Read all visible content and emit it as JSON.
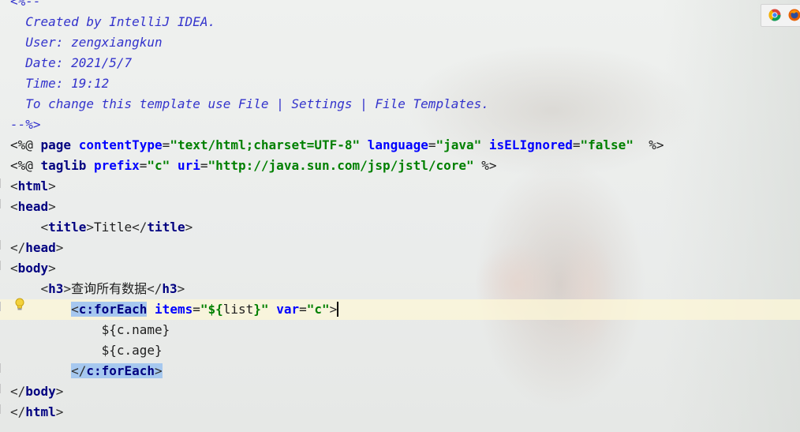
{
  "editor": {
    "lines": [
      {
        "id": "l0",
        "segs": [
          {
            "c": "c",
            "t": "<%--"
          }
        ]
      },
      {
        "id": "l1",
        "segs": [
          {
            "c": "c",
            "t": "  Created by IntelliJ IDEA."
          }
        ]
      },
      {
        "id": "l2",
        "segs": [
          {
            "c": "c",
            "t": "  User: zengxiangkun"
          }
        ]
      },
      {
        "id": "l3",
        "segs": [
          {
            "c": "c",
            "t": "  Date: 2021/5/7"
          }
        ]
      },
      {
        "id": "l4",
        "segs": [
          {
            "c": "c",
            "t": "  Time: 19:12"
          }
        ]
      },
      {
        "id": "l5",
        "segs": [
          {
            "c": "c",
            "t": "  To change this template use File | Settings | File Templates."
          }
        ]
      },
      {
        "id": "l6",
        "segs": [
          {
            "c": "c",
            "t": "--%>"
          }
        ]
      },
      {
        "id": "l7",
        "segs": [
          {
            "c": "d",
            "t": "<%@ "
          },
          {
            "c": "tg",
            "t": "page "
          },
          {
            "c": "at",
            "t": "contentType"
          },
          {
            "c": "eq",
            "t": "="
          },
          {
            "c": "st",
            "t": "\"text/html;charset=UTF-8\" "
          },
          {
            "c": "at",
            "t": "language"
          },
          {
            "c": "eq",
            "t": "="
          },
          {
            "c": "st",
            "t": "\"java\" "
          },
          {
            "c": "at",
            "t": "isELIgnored"
          },
          {
            "c": "eq",
            "t": "="
          },
          {
            "c": "st",
            "t": "\"false\""
          },
          {
            "c": "d",
            "t": "  %>"
          }
        ]
      },
      {
        "id": "l8",
        "segs": [
          {
            "c": "d",
            "t": "<%@ "
          },
          {
            "c": "tg",
            "t": "taglib "
          },
          {
            "c": "at",
            "t": "prefix"
          },
          {
            "c": "eq",
            "t": "="
          },
          {
            "c": "st",
            "t": "\"c\" "
          },
          {
            "c": "at",
            "t": "uri"
          },
          {
            "c": "eq",
            "t": "="
          },
          {
            "c": "st",
            "t": "\"http://java.sun.com/jsp/jstl/core\""
          },
          {
            "c": "d",
            "t": " %>"
          }
        ]
      },
      {
        "id": "l9",
        "segs": [
          {
            "c": "br",
            "t": "<"
          },
          {
            "c": "tg",
            "t": "html"
          },
          {
            "c": "br",
            "t": ">"
          }
        ]
      },
      {
        "id": "l10",
        "segs": [
          {
            "c": "br",
            "t": "<"
          },
          {
            "c": "tg",
            "t": "head"
          },
          {
            "c": "br",
            "t": ">"
          }
        ]
      },
      {
        "id": "l11",
        "segs": [
          {
            "c": "pl",
            "t": "    "
          },
          {
            "c": "br",
            "t": "<"
          },
          {
            "c": "tg",
            "t": "title"
          },
          {
            "c": "br",
            "t": ">"
          },
          {
            "c": "pl",
            "t": "Title"
          },
          {
            "c": "br",
            "t": "</"
          },
          {
            "c": "tg",
            "t": "title"
          },
          {
            "c": "br",
            "t": ">"
          }
        ]
      },
      {
        "id": "l12",
        "segs": [
          {
            "c": "br",
            "t": "</"
          },
          {
            "c": "tg",
            "t": "head"
          },
          {
            "c": "br",
            "t": ">"
          }
        ]
      },
      {
        "id": "l13",
        "segs": [
          {
            "c": "br",
            "t": "<"
          },
          {
            "c": "tg",
            "t": "body"
          },
          {
            "c": "br",
            "t": ">"
          }
        ]
      },
      {
        "id": "l14",
        "segs": [
          {
            "c": "pl",
            "t": "    "
          },
          {
            "c": "br",
            "t": "<"
          },
          {
            "c": "tg",
            "t": "h3"
          },
          {
            "c": "br",
            "t": ">"
          },
          {
            "c": "pl",
            "t": "查询所有数据"
          },
          {
            "c": "br",
            "t": "</"
          },
          {
            "c": "tg",
            "t": "h3"
          },
          {
            "c": "br",
            "t": ">"
          }
        ]
      },
      {
        "id": "l15",
        "caret": true,
        "segs": [
          {
            "c": "pl",
            "t": "        "
          },
          {
            "c": "br sel",
            "t": "<"
          },
          {
            "c": "tg sel",
            "t": "c:forEach"
          },
          {
            "c": "pl",
            "t": " "
          },
          {
            "c": "at",
            "t": "items"
          },
          {
            "c": "eq",
            "t": "="
          },
          {
            "c": "st",
            "t": "\"${"
          },
          {
            "c": "ex",
            "t": "list"
          },
          {
            "c": "st",
            "t": "}\" "
          },
          {
            "c": "at",
            "t": "var"
          },
          {
            "c": "eq",
            "t": "="
          },
          {
            "c": "st",
            "t": "\"c\""
          },
          {
            "c": "br",
            "t": ">"
          }
        ]
      },
      {
        "id": "l16",
        "segs": [
          {
            "c": "pl",
            "t": "            "
          },
          {
            "c": "ex",
            "t": "${"
          },
          {
            "c": "pl",
            "t": "c.name"
          },
          {
            "c": "ex",
            "t": "}"
          }
        ]
      },
      {
        "id": "l17",
        "segs": [
          {
            "c": "pl",
            "t": "            "
          },
          {
            "c": "ex",
            "t": "${"
          },
          {
            "c": "pl",
            "t": "c.age"
          },
          {
            "c": "ex",
            "t": "}"
          }
        ]
      },
      {
        "id": "l18",
        "segs": [
          {
            "c": "pl",
            "t": "        "
          },
          {
            "c": "br sel",
            "t": "</"
          },
          {
            "c": "tg sel",
            "t": "c:forEach"
          },
          {
            "c": "br sel",
            "t": ">"
          }
        ]
      },
      {
        "id": "l19",
        "segs": [
          {
            "c": "br",
            "t": "</"
          },
          {
            "c": "tg",
            "t": "body"
          },
          {
            "c": "br",
            "t": ">"
          }
        ]
      },
      {
        "id": "l20",
        "segs": [
          {
            "c": "br",
            "t": "</"
          },
          {
            "c": "tg",
            "t": "html"
          },
          {
            "c": "br",
            "t": ">"
          }
        ]
      }
    ]
  },
  "browser_bar": {
    "icons": [
      "chrome-icon",
      "firefox-icon"
    ],
    "colors": {
      "chrome": "#e8453c",
      "firefox": "#e66000"
    }
  },
  "gutter": {
    "intention_icon": "lightbulb-icon"
  }
}
